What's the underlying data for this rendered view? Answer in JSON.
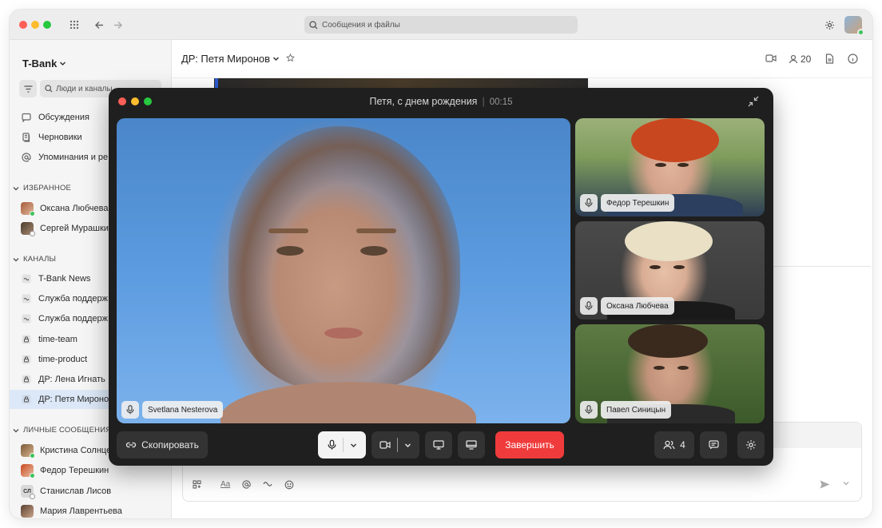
{
  "search_top": {
    "placeholder": "Сообщения и файлы"
  },
  "sidebar": {
    "workspace": "T-Bank",
    "search_placeholder": "Люди и каналы",
    "nav": [
      {
        "label": "Обсуждения",
        "icon": "discussions-icon"
      },
      {
        "label": "Черновики",
        "icon": "drafts-icon"
      },
      {
        "label": "Упоминания и ре",
        "icon": "mention-icon"
      }
    ],
    "favorites_header": "ИЗБРАННОЕ",
    "favorites": [
      {
        "label": "Оксана Любчева",
        "status": "online"
      },
      {
        "label": "Сергей Мурашки",
        "status": "offline"
      }
    ],
    "channels_header": "КАНАЛЫ",
    "channels": [
      {
        "label": "T-Bank News",
        "icon": "channel-icon"
      },
      {
        "label": "Служба поддерж",
        "icon": "channel-icon"
      },
      {
        "label": "Служба поддерж",
        "icon": "channel-icon"
      },
      {
        "label": "time-team",
        "icon": "lock-icon"
      },
      {
        "label": "time-product",
        "icon": "lock-icon"
      },
      {
        "label": "ДР: Лена Игнать",
        "icon": "lock-icon"
      },
      {
        "label": "ДР: Петя Мироно",
        "icon": "lock-icon",
        "active": true
      }
    ],
    "dm_header": "ЛИЧНЫЕ СООБЩЕНИЯ",
    "dms": [
      {
        "label": "Кристина Солнце",
        "status": "online"
      },
      {
        "label": "Федор Терешкин",
        "status": "online"
      },
      {
        "label": "Станислав Лисов",
        "initials": "СЛ",
        "status": "offline"
      },
      {
        "label": "Мария Лаврентьева",
        "status": "none"
      }
    ]
  },
  "header": {
    "title": "ДР: Петя Миронов",
    "members_count": "20"
  },
  "call": {
    "title": "Петя, с днем рождения",
    "separator": "|",
    "duration": "00:15",
    "main_participant": "Svetlana Nesterova",
    "participants": [
      "Федор Терешкин",
      "Оксана Любчева",
      "Павел Синицын"
    ],
    "copy_label": "Скопировать",
    "end_label": "Завершить",
    "participants_count": "4"
  },
  "colors": {
    "accent_blue": "#2e5bd6",
    "end_call_red": "#ef3b3b",
    "online_green": "#3ec45a"
  }
}
